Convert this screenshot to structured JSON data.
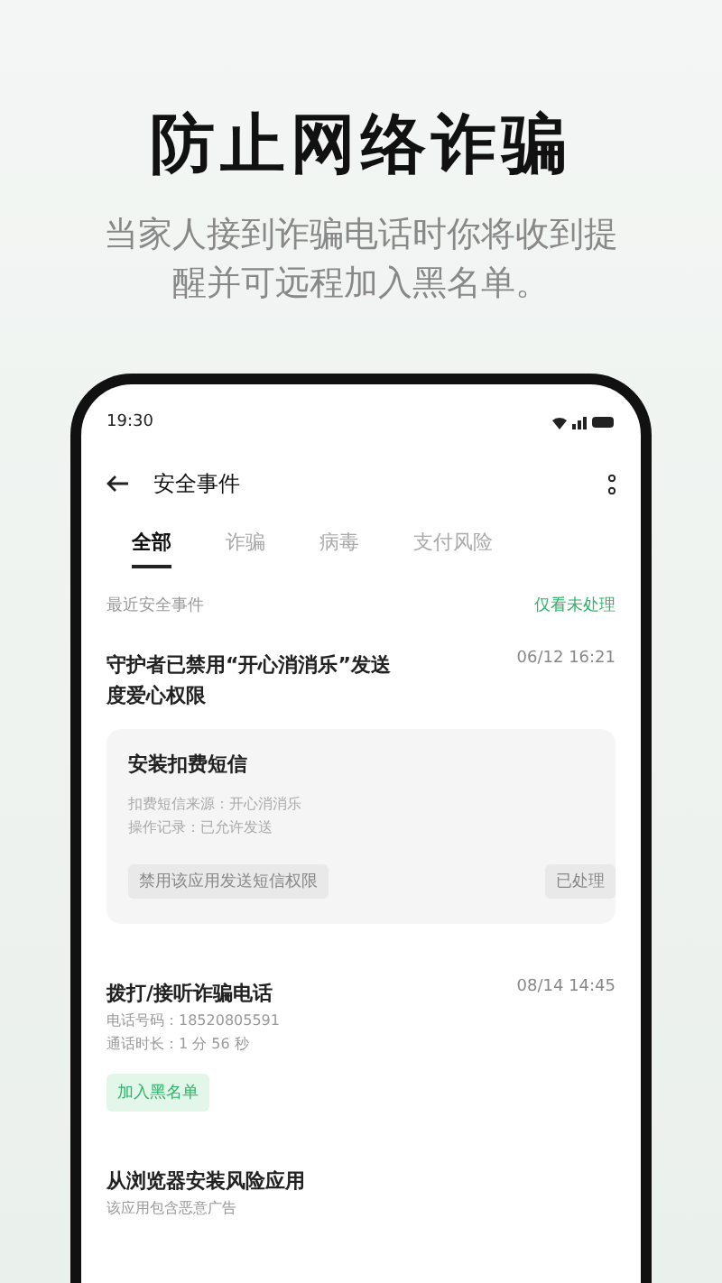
{
  "headline": "防止网络诈骗",
  "subtitle": "当家人接到诈骗电话时你将收到提醒并可远程加入黑名单。",
  "phone": {
    "status_time": "19:30",
    "title": "安全事件",
    "tabs": [
      {
        "label": "全部",
        "selected": true
      },
      {
        "label": "诈骗",
        "selected": false
      },
      {
        "label": "病毒",
        "selected": false
      },
      {
        "label": "支付风险",
        "selected": false
      }
    ],
    "section_label": "最近安全事件",
    "filter_link": "仅看未处理",
    "events": [
      {
        "title": "守护者已禁用“开心消消乐”发送度爱心权限",
        "time": "06/12 16:21",
        "card": {
          "title": "安装扣费短信",
          "lines": [
            "扣费短信来源：开心消消乐",
            "操作记录：已允许发送"
          ],
          "buttons": [
            {
              "label": "禁用该应用发送短信权限",
              "disabled": true
            },
            {
              "label": "已处理",
              "disabled": true
            }
          ]
        }
      },
      {
        "title": "拨打/接听诈骗电话",
        "time": "08/14 14:45",
        "lines": [
          "电话号码：18520805591",
          "通话时长：1 分 56 秒"
        ],
        "action": "加入黑名单"
      },
      {
        "title": "从浏览器安装风险应用",
        "lines": [
          "该应用包含恶意广告"
        ]
      }
    ]
  }
}
